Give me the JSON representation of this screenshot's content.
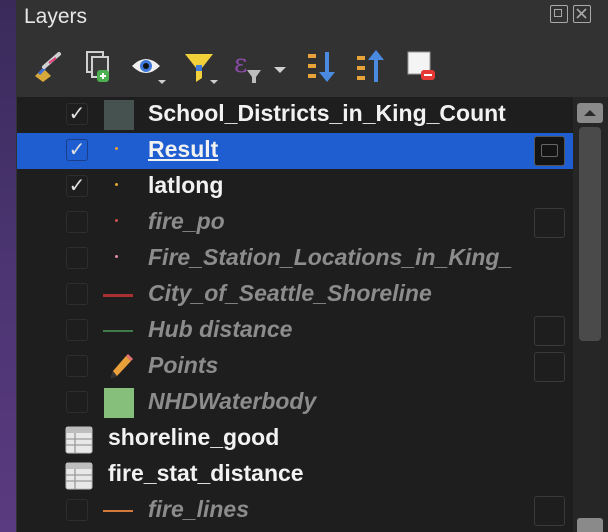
{
  "panel": {
    "title": "Layers"
  },
  "toolbar": [
    {
      "icon": "style-brush-icon"
    },
    {
      "icon": "add-group-icon"
    },
    {
      "icon": "visibility-eye-icon"
    },
    {
      "icon": "filter-funnel-icon"
    },
    {
      "icon": "filter-expression-icon"
    },
    {
      "icon": "expand-all-icon"
    },
    {
      "icon": "collapse-all-icon"
    },
    {
      "icon": "remove-layer-icon"
    }
  ],
  "layers": [
    {
      "name": "School_Districts_in_King_Count",
      "checked": true,
      "symbol": "polygon-dark-icon",
      "visible": true
    },
    {
      "name": "Result",
      "checked": true,
      "symbol": "point-orange-icon",
      "visible": true,
      "selected": true
    },
    {
      "name": "latlong",
      "checked": true,
      "symbol": "point-orange-icon",
      "visible": true
    },
    {
      "name": "fire_po",
      "checked": false,
      "symbol": "point-red-icon",
      "visible": false
    },
    {
      "name": "Fire_Station_Locations_in_King_",
      "checked": false,
      "symbol": "point-pink-icon",
      "visible": false
    },
    {
      "name": "City_of_Seattle_Shoreline",
      "checked": false,
      "symbol": "line-red-icon",
      "visible": false
    },
    {
      "name": "Hub distance",
      "checked": false,
      "symbol": "line-green-icon",
      "visible": false
    },
    {
      "name": "Points",
      "checked": false,
      "symbol": "pencil-edit-icon",
      "visible": false
    },
    {
      "name": "NHDWaterbody",
      "checked": false,
      "symbol": "polygon-green-icon",
      "visible": false
    },
    {
      "name": "shoreline_good",
      "symbol": "table-icon",
      "table": true
    },
    {
      "name": "fire_stat_distance",
      "symbol": "table-icon",
      "table": true
    },
    {
      "name": "fire_lines",
      "checked": false,
      "symbol": "line-orange-icon",
      "visible": false
    }
  ]
}
